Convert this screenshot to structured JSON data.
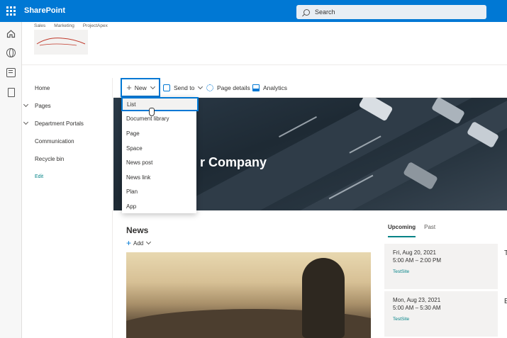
{
  "topbar": {
    "brand": "SharePoint",
    "search_placeholder": "Search"
  },
  "site_nav": [
    "Sales",
    "Marketing",
    "ProjectApex"
  ],
  "left_nav": {
    "items": [
      {
        "label": "Home"
      },
      {
        "label": "Pages"
      },
      {
        "label": "Department Portals"
      },
      {
        "label": "Communication"
      },
      {
        "label": "Recycle bin"
      }
    ],
    "edit": "Edit"
  },
  "command_bar": {
    "new_label": "New",
    "send_to_label": "Send to",
    "page_details_label": "Page details",
    "analytics_label": "Analytics"
  },
  "new_menu": [
    "List",
    "Document library",
    "Page",
    "Space",
    "News post",
    "News link",
    "Plan",
    "App"
  ],
  "hero": {
    "title": "r Company"
  },
  "news": {
    "title": "News",
    "add_label": "Add"
  },
  "events": {
    "tab_upcoming": "Upcoming",
    "tab_past": "Past",
    "items": [
      {
        "date": "Fri, Aug 20, 2021",
        "time": "5:00 AM – 2:00 PM",
        "site": "TestSite",
        "side": "T"
      },
      {
        "date": "Mon, Aug 23, 2021",
        "time": "5:00 AM – 5:30 AM",
        "site": "TestSite",
        "side": "E"
      }
    ]
  }
}
